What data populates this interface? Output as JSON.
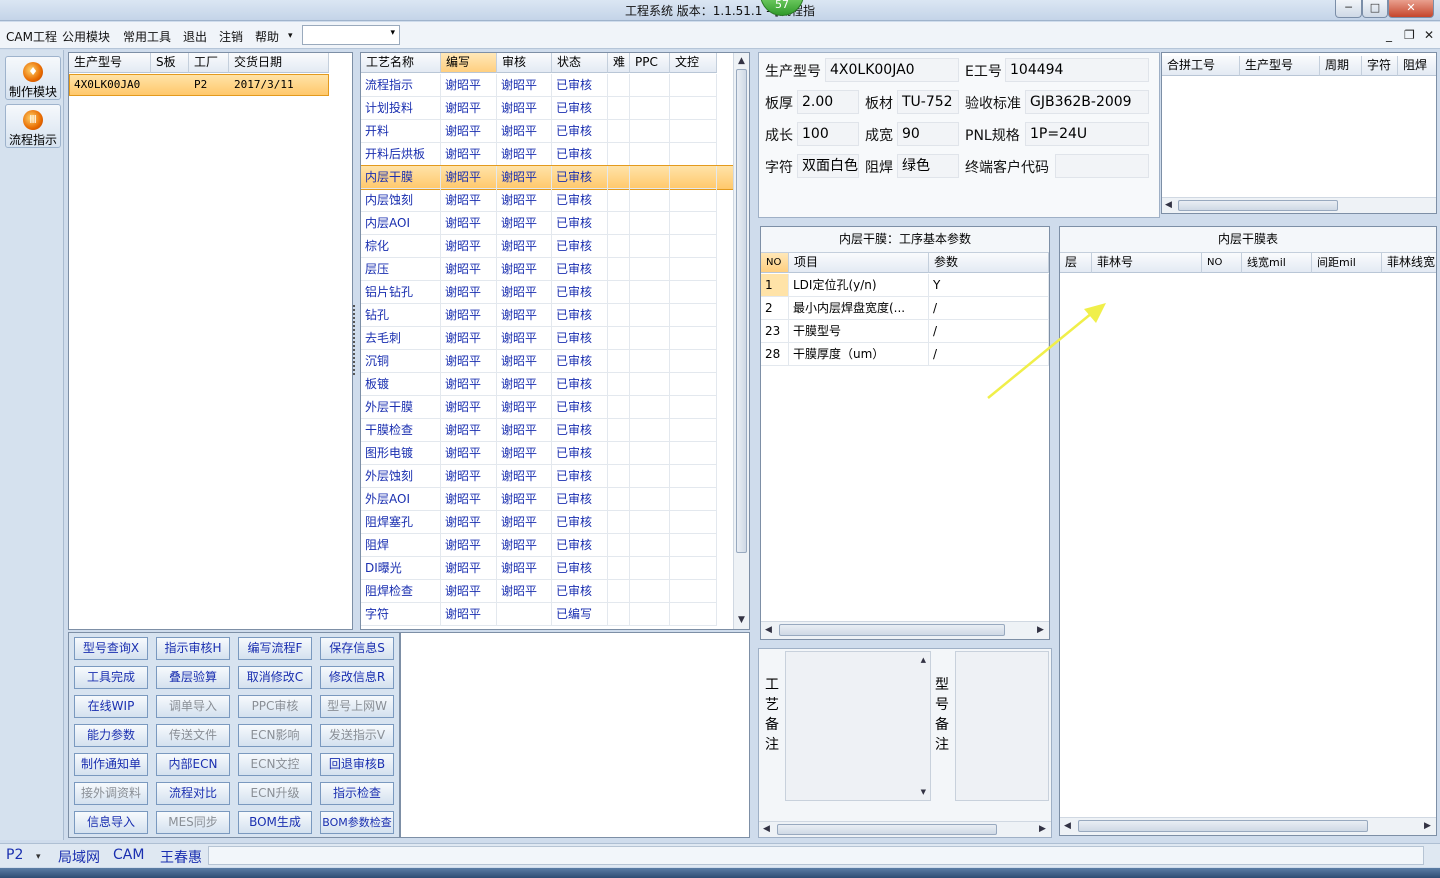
{
  "window": {
    "title": "工程系统   版本：1.1.51.1 - [流程指",
    "badge": "57",
    "btn_min": "─",
    "btn_max": "□",
    "btn_close": "✕"
  },
  "menu": {
    "items": [
      "CAM工程",
      "公用模块",
      "常用工具",
      "退出",
      "注销",
      "帮助"
    ],
    "help_arrow": "▾",
    "combo_value": "",
    "combo_arrow": "▾",
    "mdi_min": "_",
    "mdi_restore": "❐",
    "mdi_close": "✕"
  },
  "sidebar": {
    "buttons": [
      {
        "label": "制作模块",
        "icon": "flame-icon"
      },
      {
        "label": "流程指示",
        "icon": "flow-icon"
      }
    ]
  },
  "orders": {
    "headers": [
      "生产型号",
      "S板",
      "工厂",
      "交货日期"
    ],
    "rows": [
      [
        "4X0LK00JA0",
        "",
        "P2",
        "2017/3/11"
      ]
    ]
  },
  "process": {
    "headers": [
      "工艺名称",
      "编写",
      "审核",
      "状态",
      "难",
      "PPC",
      "文控"
    ],
    "selected_index": 4,
    "rows": [
      [
        "流程指示",
        "谢昭平",
        "谢昭平",
        "已审核"
      ],
      [
        "计划投料",
        "谢昭平",
        "谢昭平",
        "已审核"
      ],
      [
        "开料",
        "谢昭平",
        "谢昭平",
        "已审核"
      ],
      [
        "开料后烘板",
        "谢昭平",
        "谢昭平",
        "已审核"
      ],
      [
        "内层干膜",
        "谢昭平",
        "谢昭平",
        "已审核"
      ],
      [
        "内层蚀刻",
        "谢昭平",
        "谢昭平",
        "已审核"
      ],
      [
        "内层AOI",
        "谢昭平",
        "谢昭平",
        "已审核"
      ],
      [
        "棕化",
        "谢昭平",
        "谢昭平",
        "已审核"
      ],
      [
        "层压",
        "谢昭平",
        "谢昭平",
        "已审核"
      ],
      [
        "铝片钻孔",
        "谢昭平",
        "谢昭平",
        "已审核"
      ],
      [
        "钻孔",
        "谢昭平",
        "谢昭平",
        "已审核"
      ],
      [
        "去毛刺",
        "谢昭平",
        "谢昭平",
        "已审核"
      ],
      [
        "沉铜",
        "谢昭平",
        "谢昭平",
        "已审核"
      ],
      [
        "板镀",
        "谢昭平",
        "谢昭平",
        "已审核"
      ],
      [
        "外层干膜",
        "谢昭平",
        "谢昭平",
        "已审核"
      ],
      [
        "干膜检查",
        "谢昭平",
        "谢昭平",
        "已审核"
      ],
      [
        "图形电镀",
        "谢昭平",
        "谢昭平",
        "已审核"
      ],
      [
        "外层蚀刻",
        "谢昭平",
        "谢昭平",
        "已审核"
      ],
      [
        "外层AOI",
        "谢昭平",
        "谢昭平",
        "已审核"
      ],
      [
        "阻焊塞孔",
        "谢昭平",
        "谢昭平",
        "已审核"
      ],
      [
        "阻焊",
        "谢昭平",
        "谢昭平",
        "已审核"
      ],
      [
        "DI曝光",
        "谢昭平",
        "谢昭平",
        "已审核"
      ],
      [
        "阻焊检查",
        "谢昭平",
        "谢昭平",
        "已审核"
      ],
      [
        "字符",
        "谢昭平",
        "",
        "已编写"
      ]
    ]
  },
  "tools": {
    "buttons": [
      {
        "label": "型号查询X",
        "enabled": true
      },
      {
        "label": "指示审核H",
        "enabled": true
      },
      {
        "label": "编写流程F",
        "enabled": true
      },
      {
        "label": "保存信息S",
        "enabled": true
      },
      {
        "label": "工具完成",
        "enabled": true
      },
      {
        "label": "叠层验算",
        "enabled": true
      },
      {
        "label": "取消修改C",
        "enabled": true
      },
      {
        "label": "修改信息R",
        "enabled": true
      },
      {
        "label": "在线WIP",
        "enabled": true
      },
      {
        "label": "调单导入",
        "enabled": false
      },
      {
        "label": "PPC审核",
        "enabled": false
      },
      {
        "label": "型号上网W",
        "enabled": false
      },
      {
        "label": "能力参数",
        "enabled": true
      },
      {
        "label": "传送文件",
        "enabled": false
      },
      {
        "label": "ECN影响",
        "enabled": false
      },
      {
        "label": "发送指示V",
        "enabled": false
      },
      {
        "label": "制作通知单",
        "enabled": true
      },
      {
        "label": "内部ECN",
        "enabled": true
      },
      {
        "label": "ECN文控",
        "enabled": false
      },
      {
        "label": "回退审核B",
        "enabled": true
      },
      {
        "label": "接外调资料",
        "enabled": false
      },
      {
        "label": "流程对比",
        "enabled": true
      },
      {
        "label": "ECN升级",
        "enabled": false
      },
      {
        "label": "指示检查",
        "enabled": true
      },
      {
        "label": "信息导入",
        "enabled": true
      },
      {
        "label": "MES同步",
        "enabled": false
      },
      {
        "label": "BOM生成",
        "enabled": true
      },
      {
        "label": "BOM参数检查",
        "enabled": true
      }
    ]
  },
  "info": {
    "fields": [
      {
        "label": "生产型号",
        "value": "4X0LK00JA0"
      },
      {
        "label": "E工号",
        "value": "104494"
      },
      {
        "label": "板厚",
        "value": "2.00"
      },
      {
        "label": "板材",
        "value": "TU-752"
      },
      {
        "label": "验收标准",
        "value": "GJB362B-2009"
      },
      {
        "label": "成长",
        "value": "100"
      },
      {
        "label": "成宽",
        "value": "90"
      },
      {
        "label": "PNL规格",
        "value": "1P=24U"
      },
      {
        "label": "字符",
        "value": "双面白色"
      },
      {
        "label": "阻焊",
        "value": "绿色"
      },
      {
        "label": "终端客户代码",
        "value": ""
      }
    ]
  },
  "combine": {
    "headers": [
      "合拼工号",
      "生产型号",
      "周期",
      "字符",
      "阻焊"
    ]
  },
  "params": {
    "title": "内层干膜：工序基本参数",
    "headers": [
      "NO",
      "项目",
      "参数"
    ],
    "rows": [
      [
        "1",
        "LDI定位孔(y/n)",
        "Y"
      ],
      [
        "2",
        "最小内层焊盘宽度(...",
        "/"
      ],
      [
        "23",
        "干膜型号",
        "/"
      ],
      [
        "28",
        "干膜厚度（um）",
        "/"
      ]
    ]
  },
  "film": {
    "title": "内层干膜表",
    "headers": [
      "层",
      "菲林号",
      "NO",
      "线宽mil",
      "间距mil",
      "菲林线宽"
    ]
  },
  "notes": {
    "process_label": "工艺备注",
    "model_label": "型号备注"
  },
  "status": {
    "factory": "P2",
    "arrow": "▾",
    "items": [
      "局域网",
      "CAM",
      "王春惠"
    ]
  },
  "colors": {
    "selected_row": "#ffc86b",
    "link_text": "#1a2fb0",
    "annotation_arrow": "#f0ef4a"
  }
}
